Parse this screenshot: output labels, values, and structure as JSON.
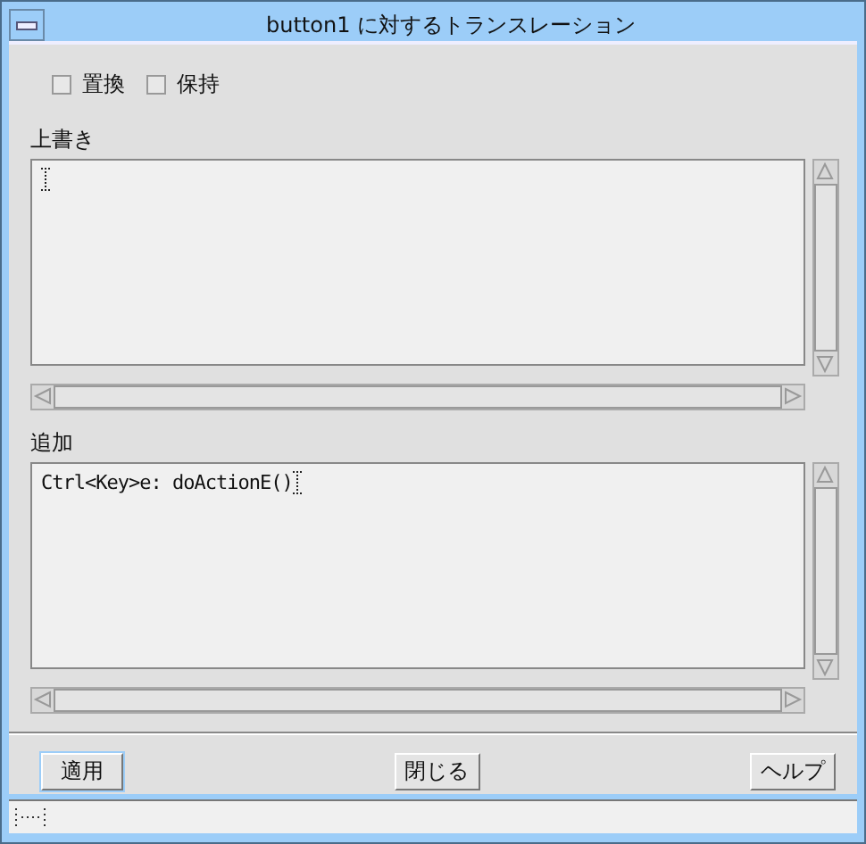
{
  "window": {
    "title": "button1 に対するトランスレーション"
  },
  "options": [
    {
      "label": "置換",
      "checked": false
    },
    {
      "label": "保持",
      "checked": false
    }
  ],
  "sections": [
    {
      "label": "上書き"
    },
    {
      "label": "追加",
      "value": "Ctrl<Key>e: doActionE()"
    }
  ],
  "buttons": [
    {
      "label": "適用",
      "focused": true
    },
    {
      "label": "閉じる",
      "focused": false
    },
    {
      "label": "ヘルプ",
      "focused": false
    }
  ]
}
